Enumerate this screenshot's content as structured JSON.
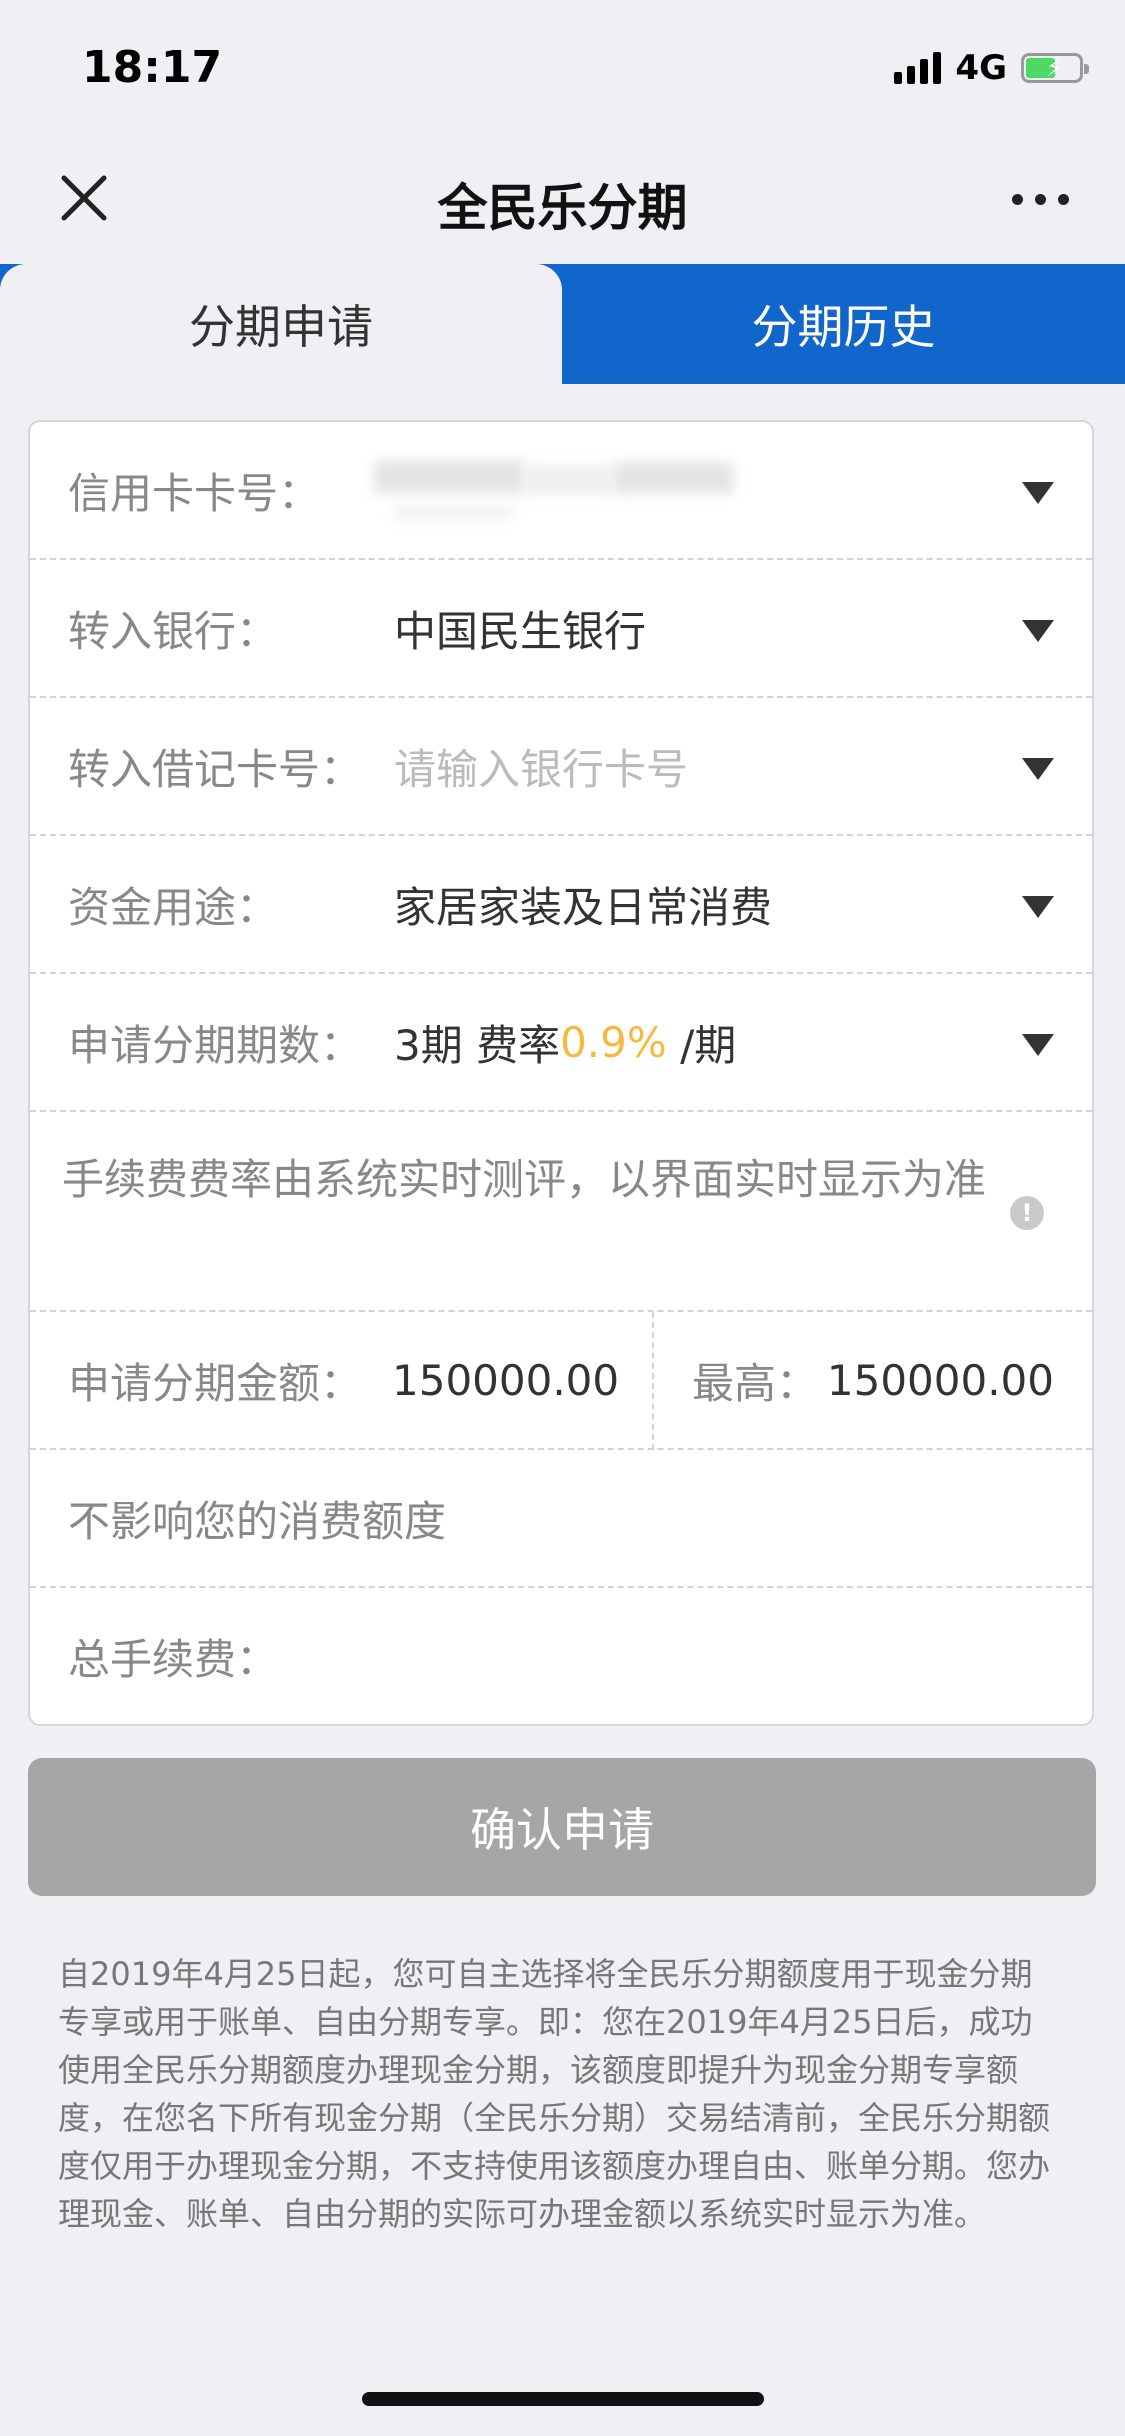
{
  "status_bar": {
    "time": "18:17",
    "network": "4G",
    "battery_level": 0.55,
    "charging": true
  },
  "nav": {
    "title": "全民乐分期",
    "close_icon": "close-icon",
    "more_icon": "more-icon"
  },
  "tabs": [
    {
      "label": "分期申请",
      "active": true
    },
    {
      "label": "分期历史",
      "active": false
    }
  ],
  "form": {
    "card_number": {
      "label": "信用卡卡号："
    },
    "bank": {
      "label": "转入银行：",
      "value": "中国民生银行"
    },
    "debit_card": {
      "label": "转入借记卡号：",
      "placeholder": "请输入银行卡号"
    },
    "purpose": {
      "label": "资金用途：",
      "value": "家居家装及日常消费"
    },
    "periods": {
      "label": "申请分期期数：",
      "value": "3期 费率",
      "rate": "0.9%",
      "suffix": " /期"
    },
    "rate_note": "手续费费率由系统实时测评，以界面实时显示为准",
    "amount": {
      "label": "申请分期金额：",
      "value": "150000.00",
      "max_label": "最高：",
      "max_value": "150000.00"
    },
    "limit_note": "不影响您的消费额度",
    "total_fee": {
      "label": "总手续费："
    }
  },
  "confirm_label": "确认申请",
  "disclaimer": "自2019年4月25日起，您可自主选择将全民乐分期额度用于现金分期专享或用于账单、自由分期专享。即：您在2019年4月25日后，成功使用全民乐分期额度办理现金分期，该额度即提升为现金分期专享额度，在您名下所有现金分期（全民乐分期）交易结清前，全民乐分期额度仅用于办理现金分期，不支持使用该额度办理自由、账单分期。您办理现金、账单、自由分期的实际可办理金额以系统实时显示为准。",
  "colors": {
    "tab_blue": "#1166cc",
    "rate_accent": "#f5b941",
    "button_disabled": "#a6a6a6",
    "background": "#efeff4"
  }
}
